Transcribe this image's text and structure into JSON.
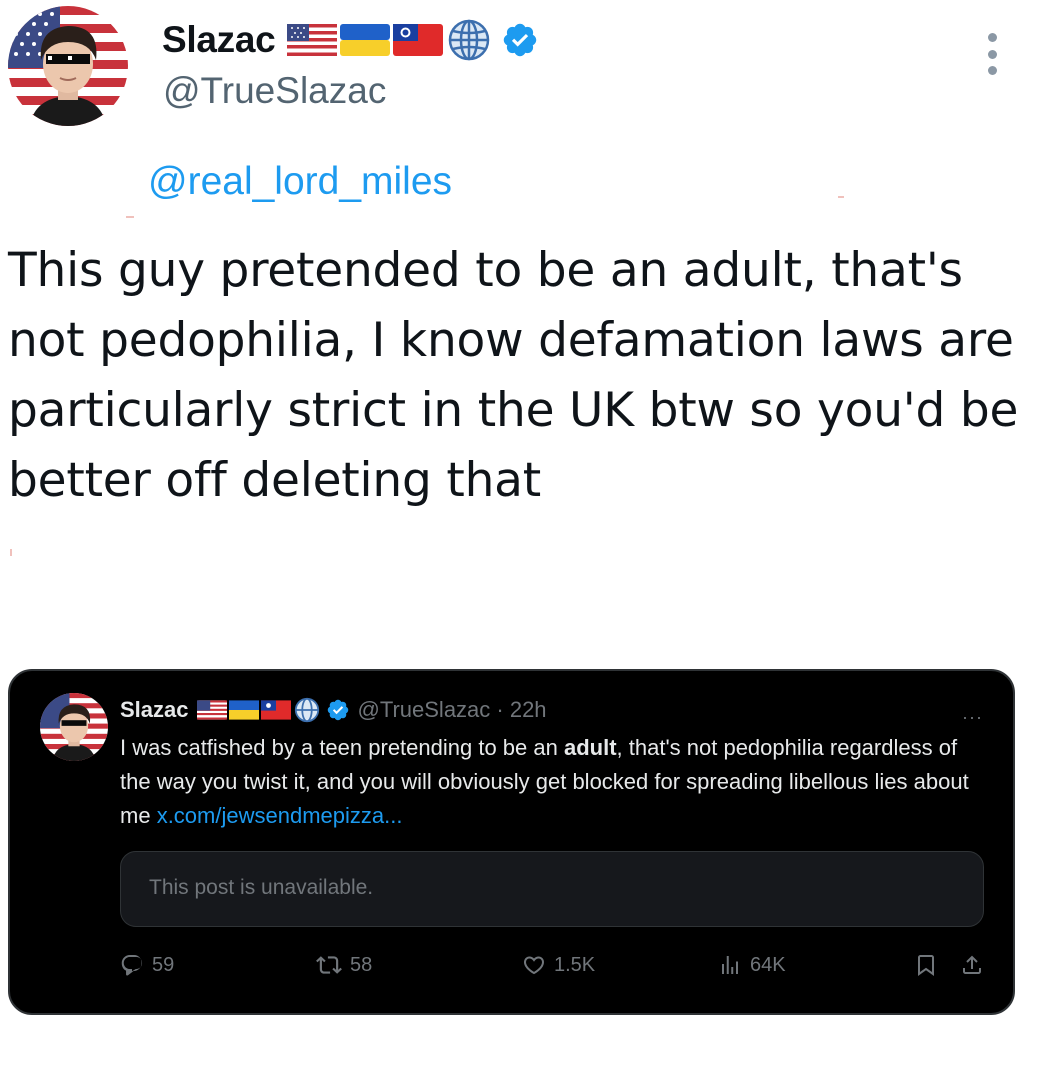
{
  "tweet": {
    "display_name": "Slazac",
    "handle": "@TrueSlazac",
    "flags": [
      "us-flag-icon",
      "ukraine-flag-icon",
      "taiwan-flag-icon",
      "globe-icon"
    ],
    "verified_icon": "verified-badge-icon",
    "more_icon": "more-vertical-icon",
    "reply_mention": "@real_lord_miles",
    "text": "This guy pretended to be an adult, that's not pedophilia, I know defamation laws are particularly strict in the UK btw so you'd be better off deleting that"
  },
  "quoted": {
    "display_name": "Slazac",
    "handle_time": "@TrueSlazac · 22h",
    "more_label": "···",
    "text_part1": "I was catfished by a teen pretending to be an ",
    "text_bold": "adult",
    "text_part2": ", that's not pedophilia regardless of the way you twist it, and you will obviously get blocked for spreading libellous lies about me ",
    "link": "x.com/jewsendmepizza...",
    "unavailable": "This post is unavailable.",
    "stats": {
      "replies": "59",
      "reposts": "58",
      "likes": "1.5K",
      "views": "64K"
    }
  },
  "colors": {
    "accent": "#1d9bf0",
    "text": "#0f1419",
    "muted": "#536471",
    "card_bg": "#000000",
    "card_text": "#e7e9ea"
  }
}
